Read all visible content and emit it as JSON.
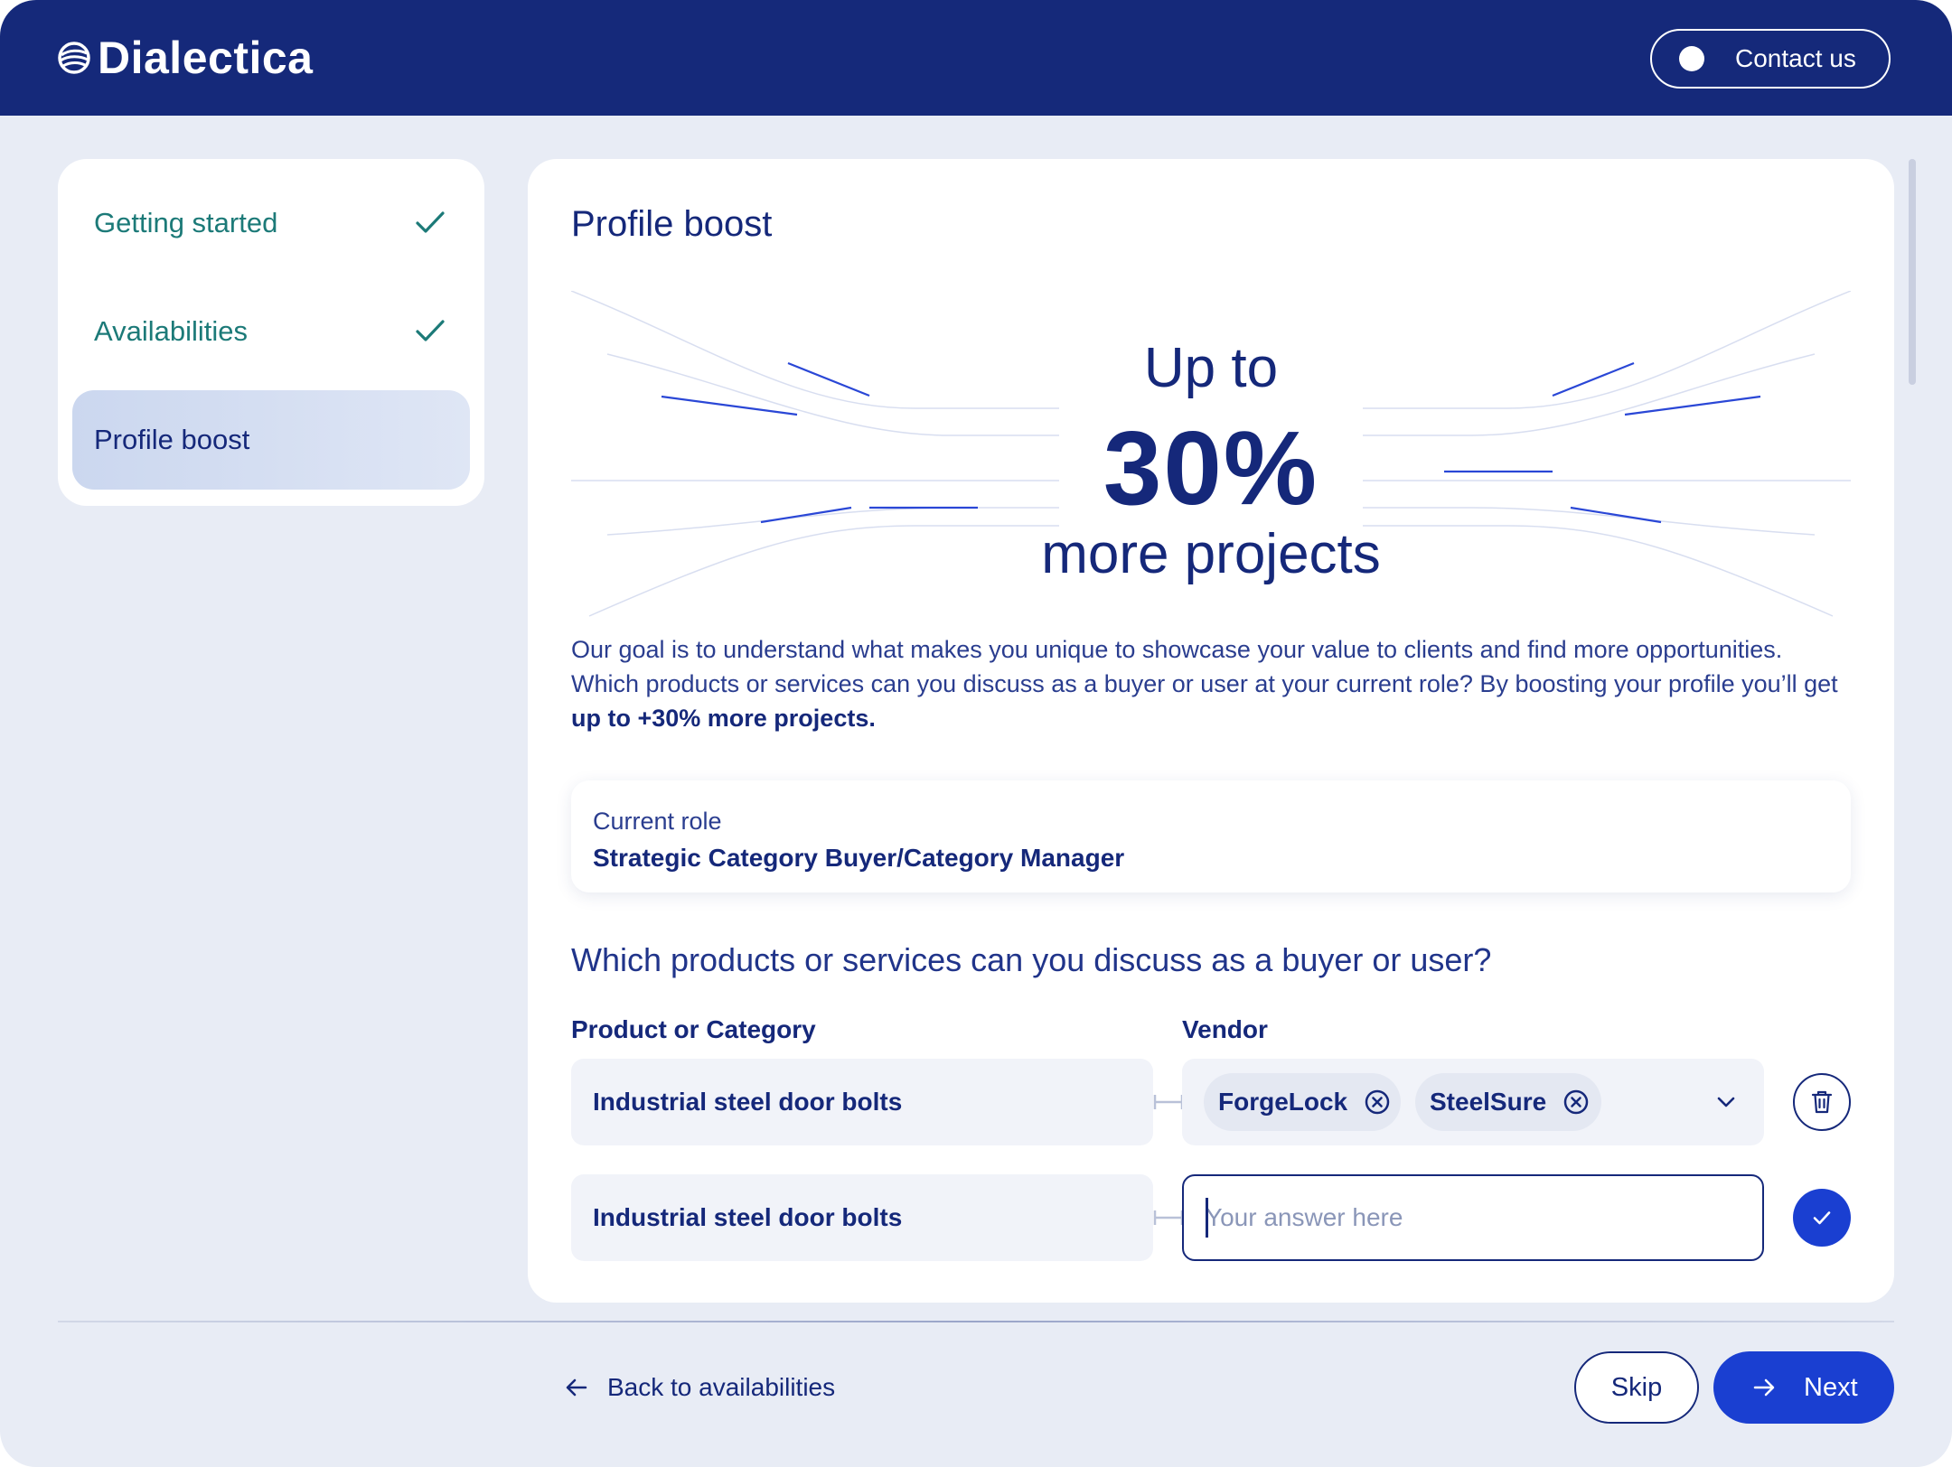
{
  "brand": {
    "name": "Dialectica",
    "icon": "globe-logo-icon"
  },
  "header": {
    "contact_label": "Contact us"
  },
  "steps": [
    {
      "label": "Getting started",
      "status": "done"
    },
    {
      "label": "Availabilities",
      "status": "done"
    },
    {
      "label": "Profile boost",
      "status": "active"
    }
  ],
  "main": {
    "title": "Profile boost",
    "hero": {
      "line1": "Up to",
      "percent": "30%",
      "line3": "more projects"
    },
    "intro": {
      "text": "Our goal is to understand what makes you unique to showcase your value to clients and find more opportunities. Which products or services can you discuss as a buyer or user at your current role? By boosting your profile you’ll get ",
      "emphasis": "up to +30% more projects."
    },
    "role": {
      "label": "Current role",
      "value": "Strategic Category Buyer/Category Manager"
    },
    "question": "Which products or services can you discuss as a buyer or user?",
    "columns": {
      "product": "Product or Category",
      "vendor": "Vendor"
    },
    "rows": [
      {
        "product": "Industrial steel door bolts",
        "vendors": [
          "ForgeLock",
          "SteelSure"
        ],
        "action": "trash-icon"
      },
      {
        "product": "Industrial steel door bolts",
        "vendor_value": "",
        "vendor_placeholder": "Your answer here",
        "action": "check-icon"
      }
    ]
  },
  "footer": {
    "back_label": "Back to availabilities",
    "skip_label": "Skip",
    "next_label": "Next"
  },
  "colors": {
    "navy": "#15297a",
    "accent": "#1a3fd1",
    "teal": "#1c7a78",
    "background": "#e8ecf5"
  }
}
